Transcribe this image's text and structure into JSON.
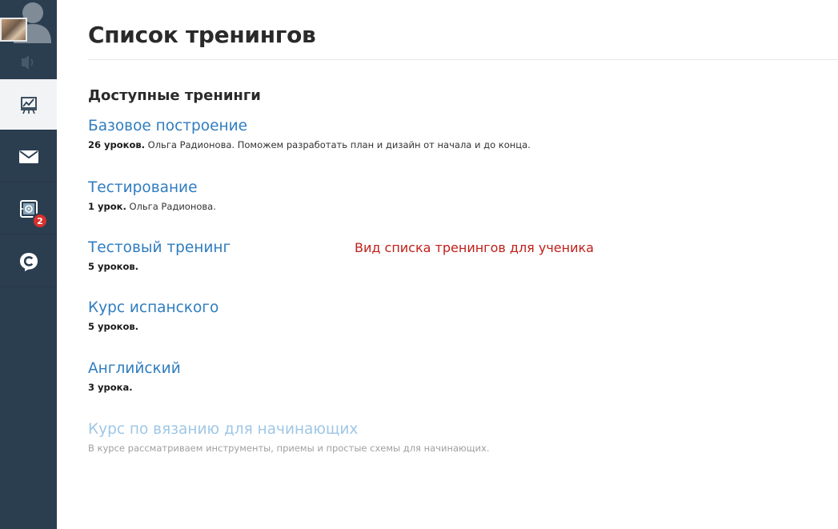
{
  "page": {
    "title": "Список тренингов",
    "section_heading": "Доступные тренинги",
    "annotation": "Вид списка тренингов для ученика"
  },
  "sidebar": {
    "avatar_icon": "user-avatar-photo",
    "sound_icon": "speaker-icon",
    "items": [
      {
        "icon": "trainings-chart-icon",
        "active": true
      },
      {
        "icon": "mail-envelope-icon",
        "active": false
      },
      {
        "icon": "safe-box-icon",
        "active": false,
        "badge": "2"
      },
      {
        "icon": "c-logo-chat-icon",
        "active": false
      }
    ]
  },
  "trainings": [
    {
      "title": "Базовое построение",
      "lessons": "26 уроков.",
      "details": " Ольга Радионова. Поможем разработать план и дизайн от начала и до конца.",
      "muted": false
    },
    {
      "title": "Тестирование",
      "lessons": "1 урок.",
      "details": " Ольга Радионова.",
      "muted": false
    },
    {
      "title": "Тестовый тренинг",
      "lessons": "5 уроков.",
      "details": "",
      "muted": false
    },
    {
      "title": "Курс испанского",
      "lessons": "5 уроков.",
      "details": "",
      "muted": false
    },
    {
      "title": "Английский",
      "lessons": "3 урока.",
      "details": "",
      "muted": false
    },
    {
      "title": "Курс по вязанию для начинающих",
      "lessons": "",
      "details": "В курсе рассматриваем инструменты, приемы и простые схемы для начинающих.",
      "muted": true
    }
  ],
  "colors": {
    "sidebar_bg": "#2b3e50",
    "link": "#2f7dbf",
    "link_muted": "#9fc7e6",
    "annotation": "#c0201a",
    "badge": "#d9302c"
  }
}
